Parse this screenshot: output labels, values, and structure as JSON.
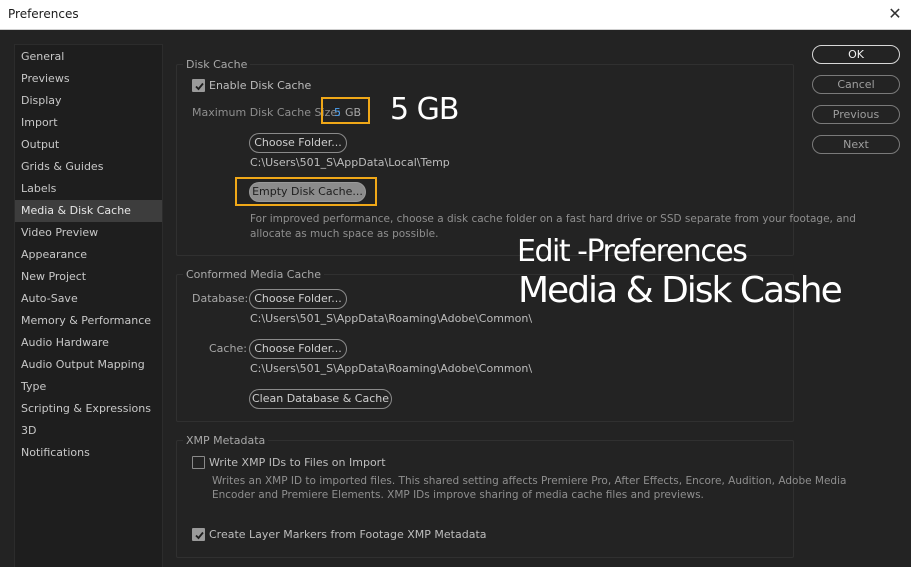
{
  "window": {
    "title": "Preferences",
    "close_glyph": "✕"
  },
  "sidebar": {
    "items": [
      {
        "label": "General"
      },
      {
        "label": "Previews"
      },
      {
        "label": "Display"
      },
      {
        "label": "Import"
      },
      {
        "label": "Output"
      },
      {
        "label": "Grids & Guides"
      },
      {
        "label": "Labels"
      },
      {
        "label": "Media & Disk Cache"
      },
      {
        "label": "Video Preview"
      },
      {
        "label": "Appearance"
      },
      {
        "label": "New Project"
      },
      {
        "label": "Auto-Save"
      },
      {
        "label": "Memory & Performance"
      },
      {
        "label": "Audio Hardware"
      },
      {
        "label": "Audio Output Mapping"
      },
      {
        "label": "Type"
      },
      {
        "label": "Scripting & Expressions"
      },
      {
        "label": "3D"
      },
      {
        "label": "Notifications"
      }
    ],
    "active": "Media & Disk Cache"
  },
  "disk_cache": {
    "title": "Disk Cache",
    "enable_label": "Enable Disk Cache",
    "enable_checked": true,
    "max_size_label": "Maximum Disk Cache Size:",
    "max_size_value": "5",
    "max_size_unit": "GB",
    "choose_folder_label": "Choose Folder...",
    "path": "C:\\Users\\501_S\\AppData\\Local\\Temp",
    "empty_cache_label": "Empty Disk Cache...",
    "hint_line1": "For improved performance, choose a disk cache folder on a fast hard drive or SSD separate from your footage, and",
    "hint_line2": "allocate as much space as possible."
  },
  "conformed_media_cache": {
    "title": "Conformed Media Cache",
    "database_label": "Database:",
    "database_button": "Choose Folder...",
    "database_path": "C:\\Users\\501_S\\AppData\\Roaming\\Adobe\\Common\\",
    "cache_label": "Cache:",
    "cache_button": "Choose Folder...",
    "cache_path": "C:\\Users\\501_S\\AppData\\Roaming\\Adobe\\Common\\",
    "clean_label": "Clean Database & Cache"
  },
  "xmp": {
    "title": "XMP Metadata",
    "write_label": "Write XMP IDs to Files on Import",
    "write_checked": false,
    "desc_line1": "Writes an XMP ID to imported files. This shared setting affects Premiere Pro, After Effects, Encore, Audition, Adobe Media",
    "desc_line2": "Encoder and Premiere Elements. XMP IDs improve sharing of media cache files and previews.",
    "markers_label": "Create Layer Markers from Footage XMP Metadata",
    "markers_checked": true
  },
  "buttons": {
    "ok": "OK",
    "cancel": "Cancel",
    "previous": "Previous",
    "next": "Next"
  },
  "annotations": {
    "size_callout": "5 GB",
    "line1": "Edit -Preferences",
    "line2": "Media & Disk Cashe",
    "highlight_color": "#f0a818"
  }
}
